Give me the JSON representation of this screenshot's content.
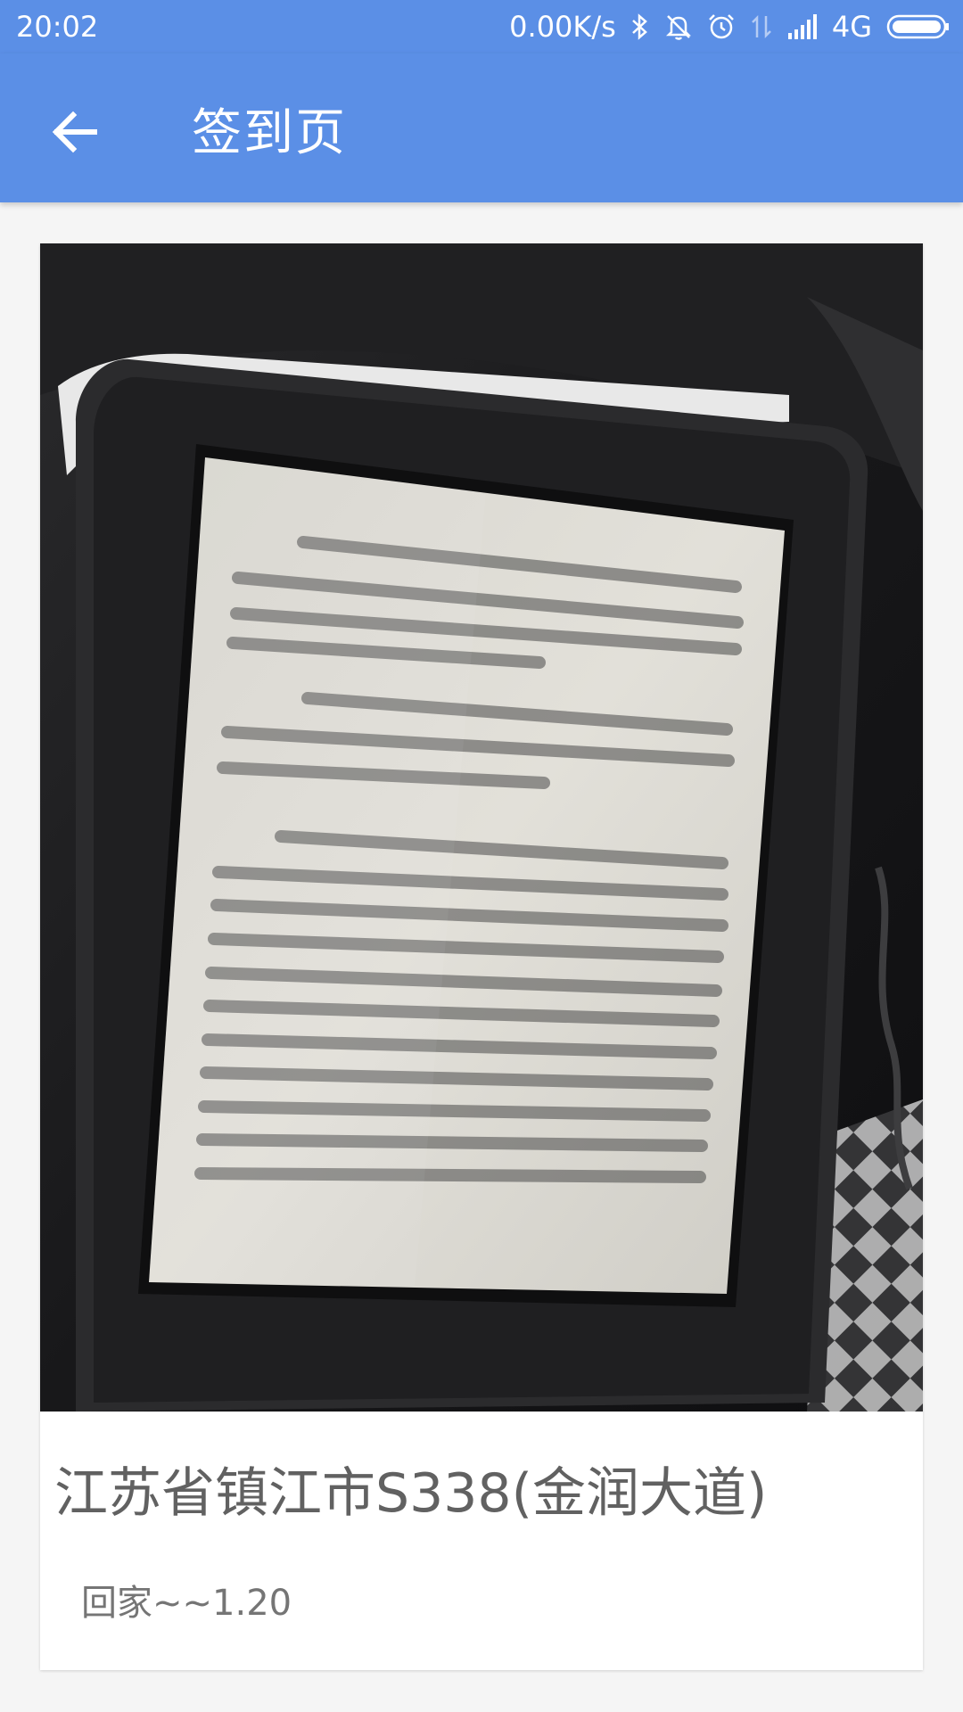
{
  "status_bar": {
    "time": "20:02",
    "net_speed": "0.00K/s",
    "network_type": "4G",
    "icons": [
      "bluetooth-icon",
      "bell-muted-icon",
      "alarm-icon",
      "data-transfer-icon",
      "signal-icon",
      "battery-icon"
    ]
  },
  "app_bar": {
    "back_icon": "arrow-left-icon",
    "title": "签到页",
    "color": "#5b8fe6"
  },
  "checkin": {
    "photo_subject": "e-reader-photo",
    "location": "江苏省镇江市S338(金润大道)",
    "note": "回家~~1.20"
  }
}
